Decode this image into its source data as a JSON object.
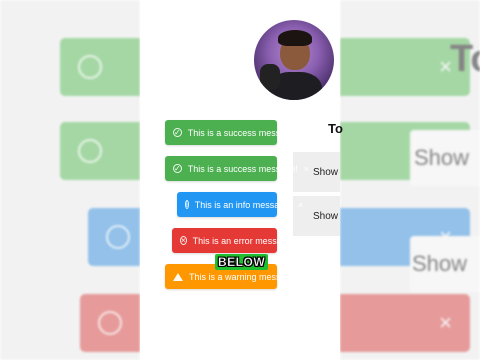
{
  "background": {
    "left_toasts": [
      {
        "icon": "check-circle-icon",
        "color": "#5cb85c"
      },
      {
        "icon": "check-circle-icon",
        "color": "#5cb85c"
      },
      {
        "icon": "info-circle-icon",
        "color": "#3b8fd8"
      },
      {
        "icon": "x-circle-icon",
        "color": "#d24a48"
      }
    ],
    "right_title": "To",
    "right_buttons": [
      "Show",
      "Show"
    ]
  },
  "heading": "To",
  "toasts": [
    {
      "type": "success",
      "icon": "check-circle-icon",
      "message": "This is a success message!",
      "close": "×"
    },
    {
      "type": "success",
      "icon": "check-circle-icon",
      "message": "This is a success message!",
      "close": "×"
    },
    {
      "type": "info",
      "icon": "info-circle-icon",
      "message": "This is an info message!",
      "close": "×"
    },
    {
      "type": "error",
      "icon": "x-circle-icon",
      "message": "This is an error message!",
      "close": "×"
    },
    {
      "type": "warning",
      "icon": "warning-triangle-icon",
      "message": "This is a warning message!",
      "close": "×"
    }
  ],
  "side_buttons": [
    "Show",
    "Show"
  ],
  "caption": "BELOW",
  "colors": {
    "success": "#4caf50",
    "info": "#2196f3",
    "error": "#e53935",
    "warning": "#ff9800"
  }
}
